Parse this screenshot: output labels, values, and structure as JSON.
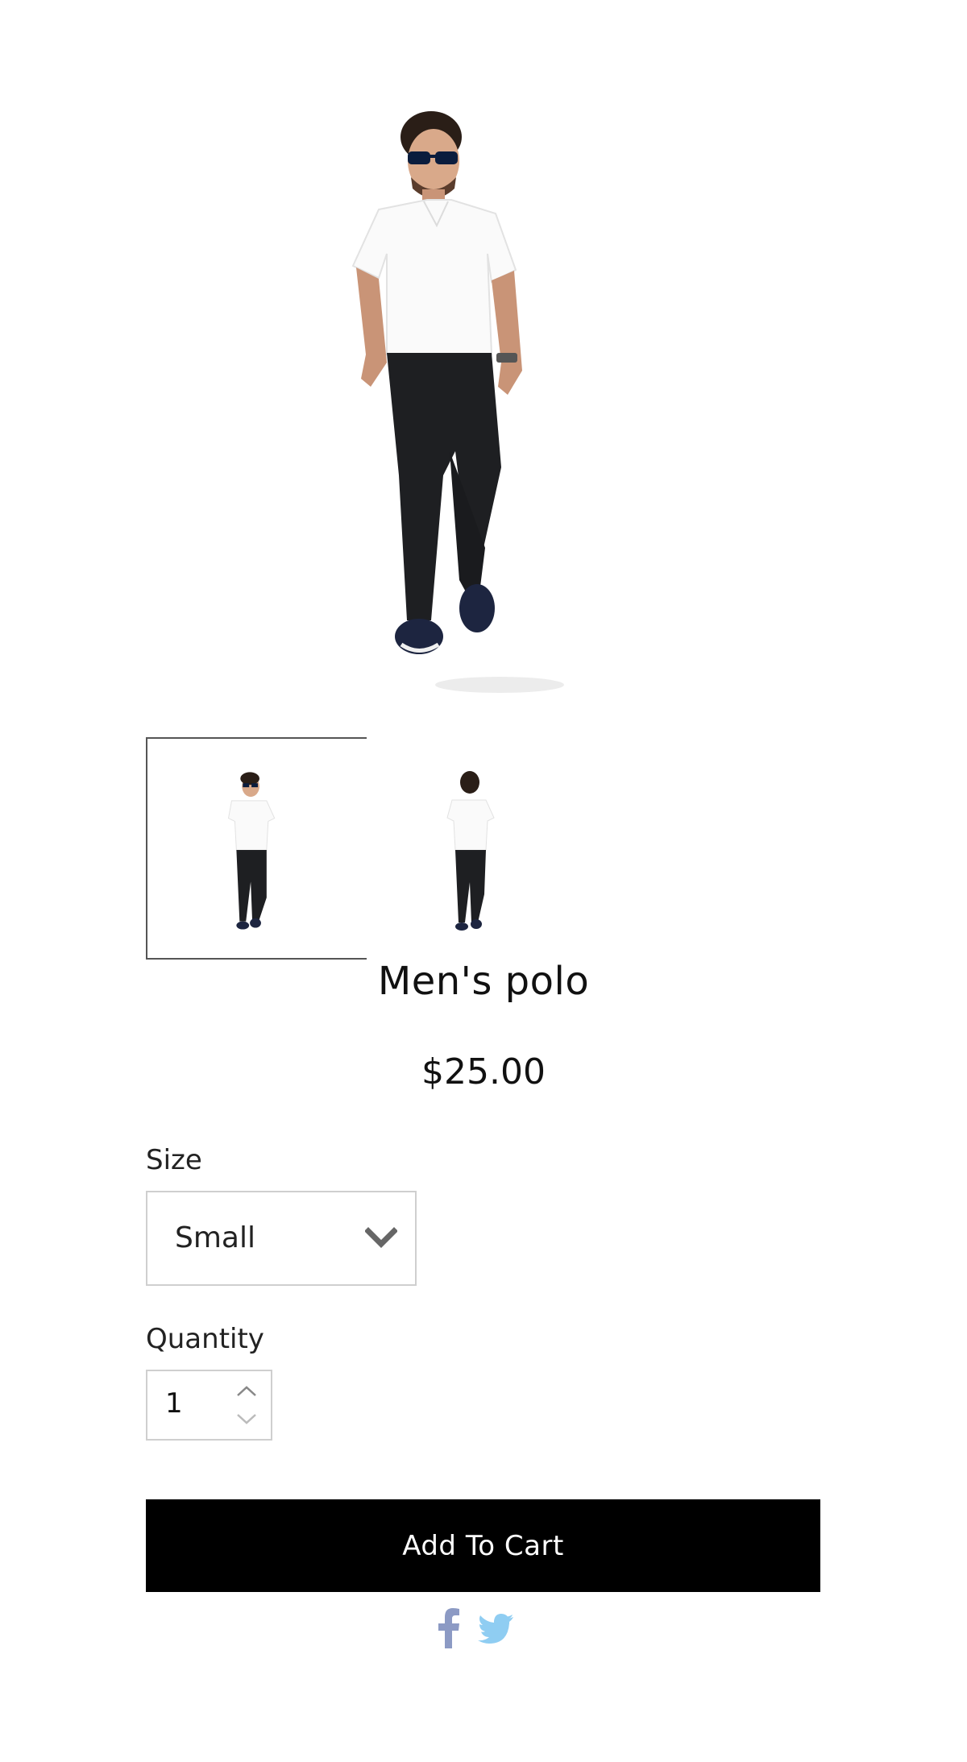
{
  "product": {
    "title": "Men's polo",
    "price": "$25.00"
  },
  "gallery": {
    "main_image": "model-front-white-polo",
    "thumbnails": [
      {
        "name": "model-front",
        "selected": true
      },
      {
        "name": "model-back",
        "selected": false
      }
    ]
  },
  "size": {
    "label": "Size",
    "selected": "Small"
  },
  "quantity": {
    "label": "Quantity",
    "value": "1"
  },
  "cart": {
    "button_label": "Add To Cart"
  },
  "social": {
    "icons": [
      "facebook-icon",
      "twitter-icon"
    ],
    "facebook_color": "#8c9ac4",
    "twitter_color": "#8fcdf2"
  },
  "colors": {
    "button_bg": "#000000",
    "button_text": "#ffffff",
    "border": "#cfcfcf",
    "selected_thumb_border": "#555555"
  }
}
